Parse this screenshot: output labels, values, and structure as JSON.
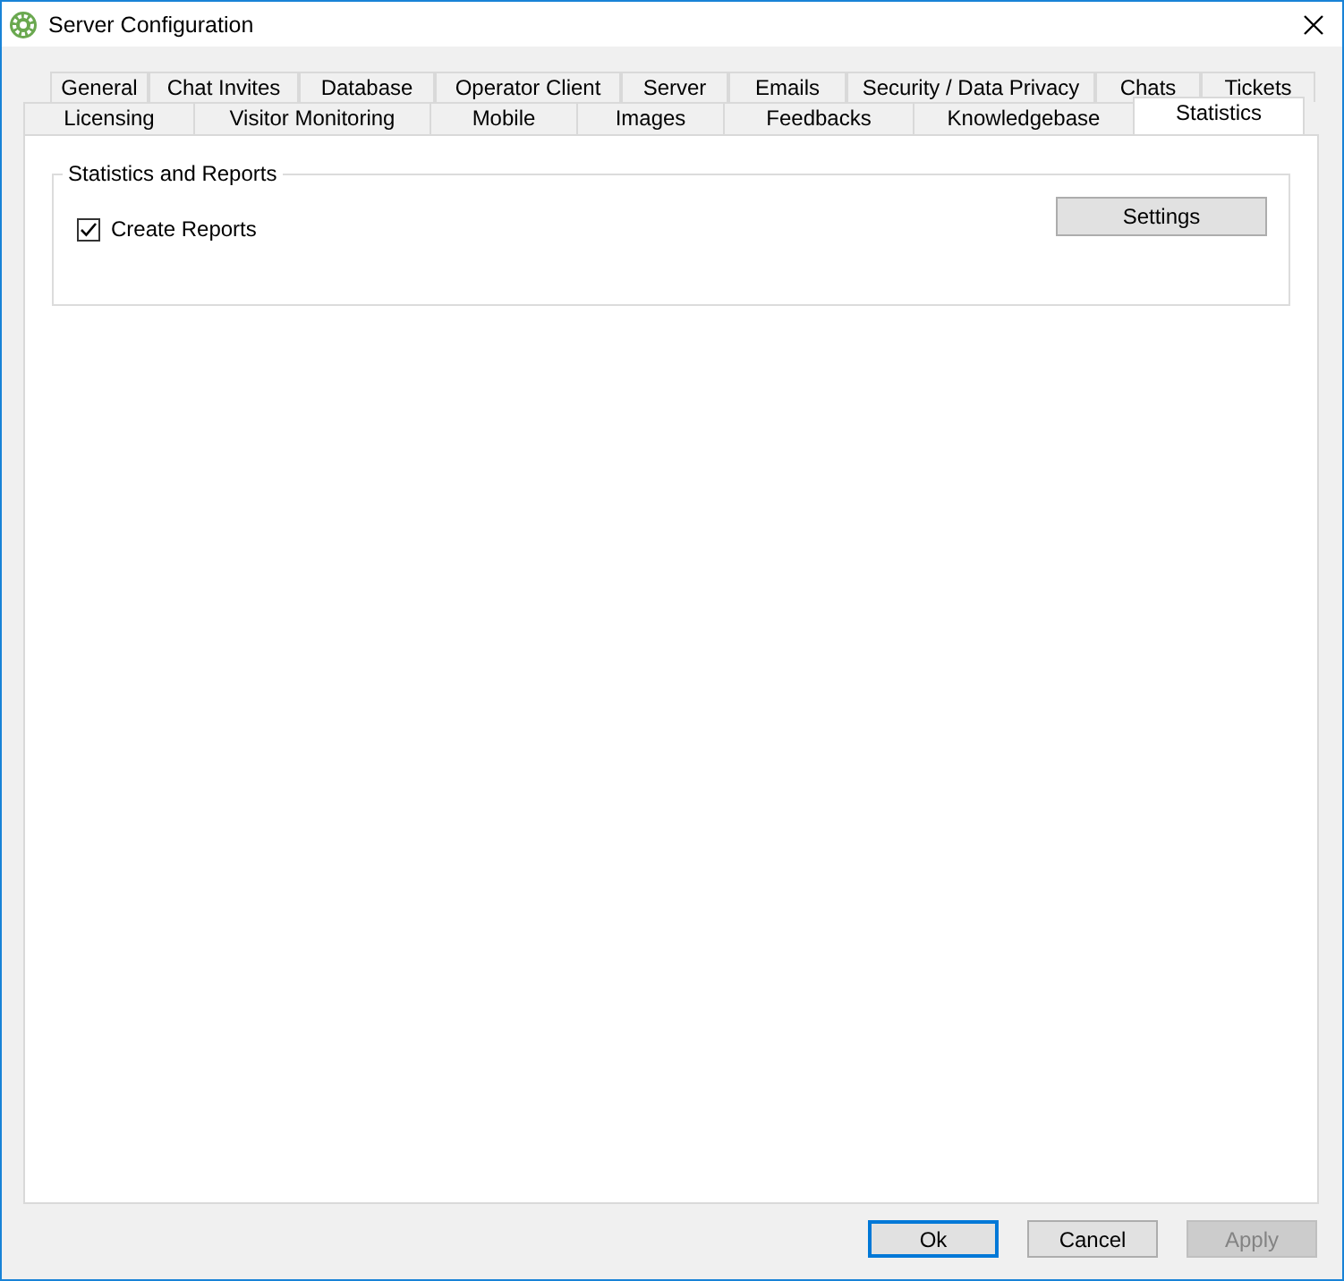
{
  "window": {
    "title": "Server Configuration"
  },
  "tab_rows": [
    [
      {
        "label": "General",
        "selected": false
      },
      {
        "label": "Chat Invites",
        "selected": false
      },
      {
        "label": "Database",
        "selected": false
      },
      {
        "label": "Operator Client",
        "selected": false
      },
      {
        "label": "Server",
        "selected": false
      },
      {
        "label": "Emails",
        "selected": false
      },
      {
        "label": "Security / Data Privacy",
        "selected": false
      },
      {
        "label": "Chats",
        "selected": false
      },
      {
        "label": "Tickets",
        "selected": false
      }
    ],
    [
      {
        "label": "Licensing",
        "selected": false
      },
      {
        "label": "Visitor Monitoring",
        "selected": false
      },
      {
        "label": "Mobile",
        "selected": false
      },
      {
        "label": "Images",
        "selected": false
      },
      {
        "label": "Feedbacks",
        "selected": false
      },
      {
        "label": "Knowledgebase",
        "selected": false
      },
      {
        "label": "Statistics",
        "selected": true
      }
    ]
  ],
  "group": {
    "title": "Statistics and Reports",
    "checkbox": {
      "label": "Create Reports",
      "checked": true
    },
    "button": "Settings"
  },
  "buttons": [
    {
      "label": "Ok",
      "default": true,
      "disabled": false
    },
    {
      "label": "Cancel",
      "default": false,
      "disabled": false
    },
    {
      "label": "Apply",
      "default": false,
      "disabled": true
    }
  ]
}
